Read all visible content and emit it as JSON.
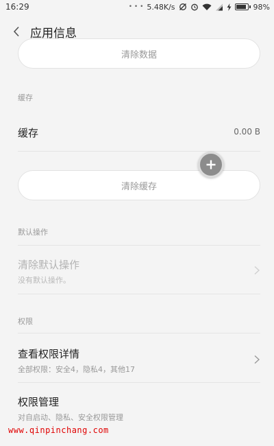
{
  "status_bar": {
    "time": "16:29",
    "speed": "5.48K/s",
    "battery": "98%",
    "battery_level": 0.98
  },
  "header": {
    "back_icon": "chevron-left-icon",
    "title": "应用信息"
  },
  "storage": {
    "clear_data_button": "清除数据"
  },
  "cache": {
    "section_label": "缓存",
    "row_label": "缓存",
    "row_value": "0.00 B",
    "clear_cache_button": "清除缓存"
  },
  "default_actions": {
    "section_label": "默认操作",
    "clear_defaults_title": "清除默认操作",
    "clear_defaults_sub": "没有默认操作。"
  },
  "permissions": {
    "section_label": "权限",
    "details_title": "查看权限详情",
    "details_sub": "全部权限：安全4，隐私4，其他17",
    "manage_title": "权限管理",
    "manage_sub": "对自启动、隐私、安全权限管理"
  },
  "floating_button": {
    "icon": "plus-icon"
  },
  "watermark": "www.qinpinchang.com"
}
